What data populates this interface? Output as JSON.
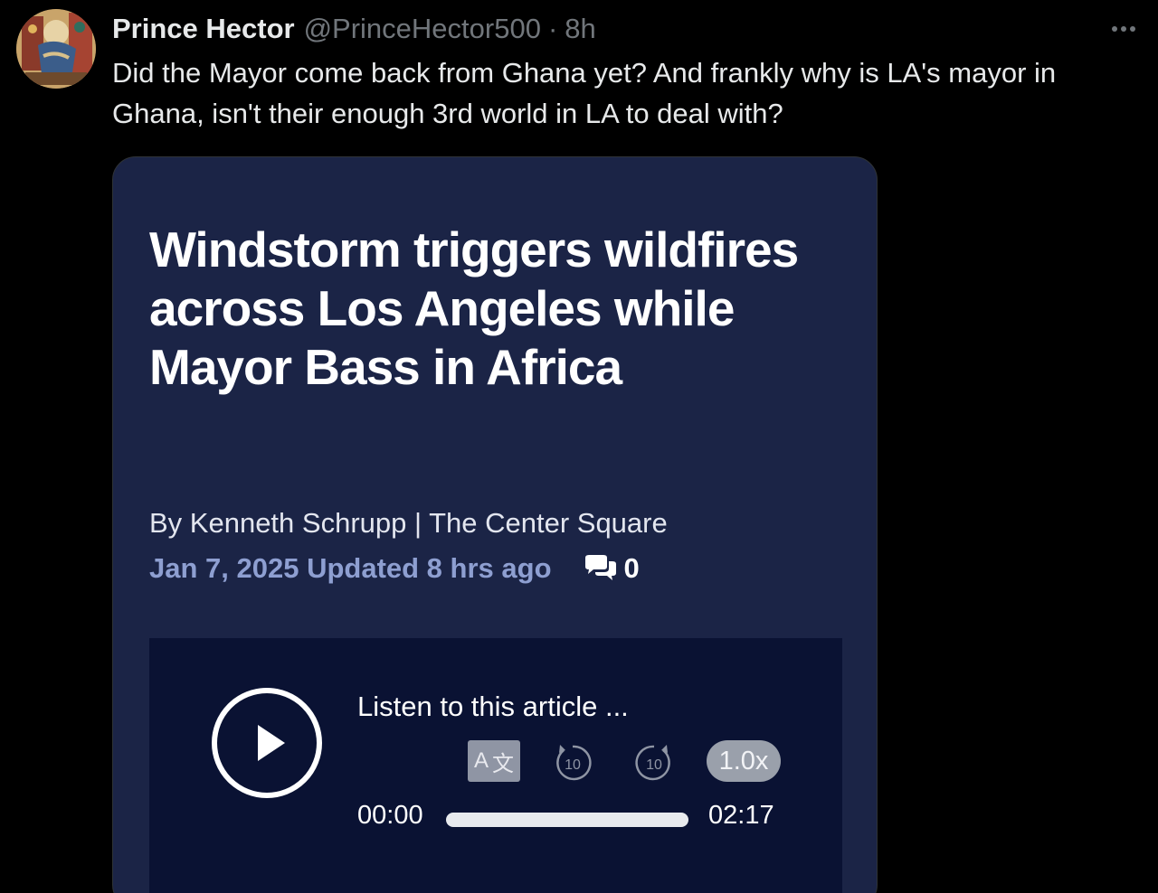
{
  "tweet": {
    "author_name": "Prince Hector",
    "handle": "@PrinceHector500",
    "separator": "·",
    "time": "8h",
    "text": "Did the Mayor come back from Ghana yet? And frankly why is LA's mayor in Ghana, isn't their enough 3rd world in LA to deal with?"
  },
  "article": {
    "headline": "Windstorm triggers wildfires across Los Angeles while Mayor Bass in Africa",
    "byline": "By Kenneth Schrupp | The Center Square",
    "date": "Jan 7, 2025 Updated 8 hrs ago",
    "comment_count": "0"
  },
  "player": {
    "listen_label": "Listen to this article ...",
    "translate_label_a": "A",
    "translate_label_zh": "文",
    "skip_back_label": "10",
    "skip_forward_label": "10",
    "speed_label": "1.0x",
    "current_time": "00:00",
    "total_time": "02:17",
    "progress_fraction": 0.0
  },
  "icons": {
    "more": "more-horizontal-icon",
    "comment": "comment-bubbles-icon",
    "play": "play-icon",
    "translate": "translate-icon",
    "skip_back": "rewind-10-icon",
    "skip_forward": "forward-10-icon"
  },
  "colors": {
    "background": "#000000",
    "card_background": "#1b2446",
    "player_background": "#0a1233",
    "date_accent": "#8e9fd1",
    "secondary_text": "#71767b"
  }
}
